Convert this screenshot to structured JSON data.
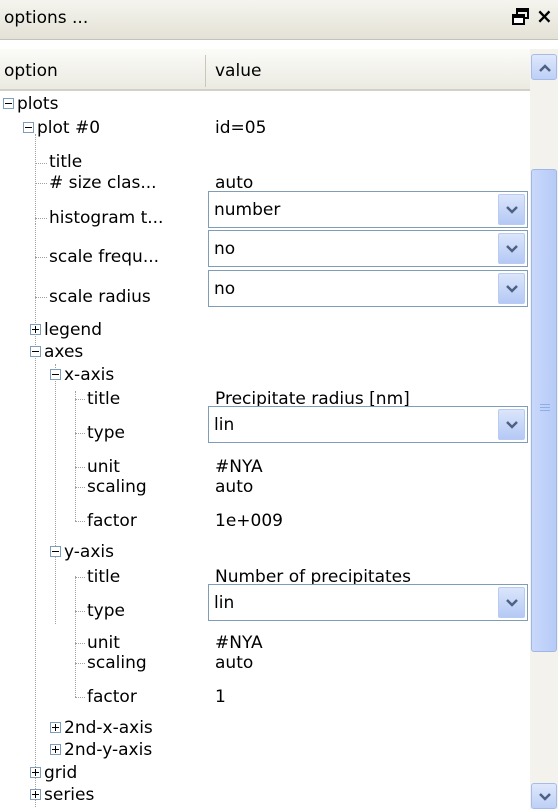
{
  "window": {
    "title": "options ...",
    "dock_icon": "restore-window-icon",
    "close_glyph": "×"
  },
  "columns": {
    "option": "option",
    "value": "value"
  },
  "tree": {
    "plots": "plots",
    "plot0": {
      "label": "plot #0",
      "value": "id=05"
    },
    "title": "title",
    "size_classes": {
      "label": "# size clas...",
      "value": "auto"
    },
    "histogram_type": {
      "label": "histogram t...",
      "value": "number"
    },
    "scale_frequency": {
      "label": "scale frequ...",
      "value": "no"
    },
    "scale_radius": {
      "label": "scale radius",
      "value": "no"
    },
    "legend": "legend",
    "axes": "axes",
    "x_axis": {
      "label": "x-axis",
      "title": {
        "label": "title",
        "value": "Precipitate radius [nm]"
      },
      "type": {
        "label": "type",
        "value": "lin"
      },
      "unit": {
        "label": "unit",
        "value": "#NYA"
      },
      "scaling": {
        "label": "scaling",
        "value": "auto"
      },
      "factor": {
        "label": "factor",
        "value": "1e+009"
      }
    },
    "y_axis": {
      "label": "y-axis",
      "title": {
        "label": "title",
        "value": "Number of precipitates"
      },
      "type": {
        "label": "type",
        "value": "lin"
      },
      "unit": {
        "label": "unit",
        "value": "#NYA"
      },
      "scaling": {
        "label": "scaling",
        "value": "auto"
      },
      "factor": {
        "label": "factor",
        "value": "1"
      }
    },
    "second_x_axis": "2nd-x-axis",
    "second_y_axis": "2nd-y-axis",
    "grid": "grid",
    "series": "series"
  },
  "colors": {
    "combo_border": "#7f9db9",
    "button_blue": "#b4c9f5",
    "header_bg": "#ebeae2"
  }
}
